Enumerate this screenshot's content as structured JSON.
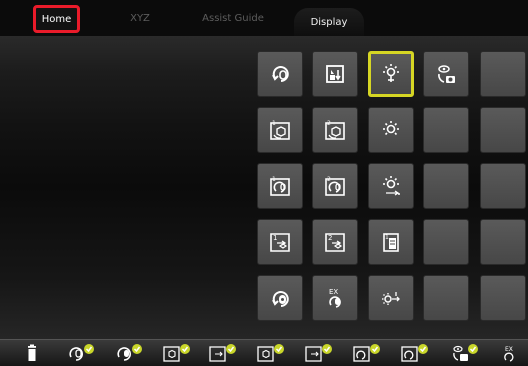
{
  "tabs": {
    "home": "Home",
    "xyz": "XYZ",
    "assist_guide": "Assist Guide",
    "display": "Display"
  },
  "tile_grid": {
    "rows": [
      [
        "rotate-icon",
        "info-scroll-icon",
        "brightness-icon",
        "camera-rotate-icon",
        "empty"
      ],
      [
        "rotate-cube-1-icon",
        "rotate-cube-2-icon",
        "brightness-icon",
        "empty",
        "empty"
      ],
      [
        "rotate-1-icon",
        "rotate-2-icon",
        "brightness-plus-icon",
        "empty",
        "empty"
      ],
      [
        "panel-1-icon",
        "panel-2-icon",
        "document-stack-icon",
        "empty",
        "empty"
      ],
      [
        "rotate-a-icon",
        "rotate-ex-icon",
        "brightness-arrow-icon",
        "empty",
        "empty"
      ]
    ],
    "selected": "row1-col3"
  },
  "bottom_bar": {
    "items": [
      "trash-icon",
      "rotate-icon",
      "rotate-a-icon",
      "rotate-cube-1-icon",
      "panel-1-icon",
      "rotate-cube-2-icon",
      "panel-2-icon",
      "rotate-1-icon",
      "rotate-2-icon",
      "camera-rotate-icon",
      "rotate-ex-icon"
    ],
    "check_color": "#c9d62a"
  },
  "colors": {
    "accent_selected": "#d6d624",
    "home_highlight": "#ea1b2a"
  }
}
